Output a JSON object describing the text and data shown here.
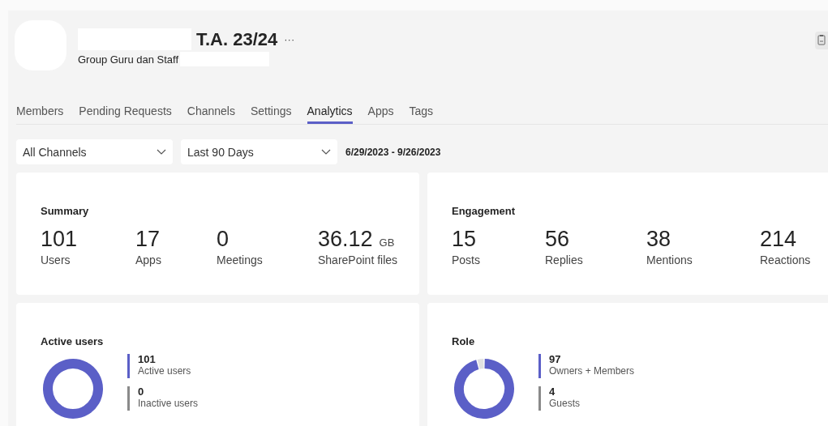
{
  "header": {
    "title": "T.A. 23/24",
    "more": "···",
    "subtitle": "Group Guru dan Staff"
  },
  "tabs": [
    {
      "label": "Members",
      "selected": false
    },
    {
      "label": "Pending Requests",
      "selected": false
    },
    {
      "label": "Channels",
      "selected": false
    },
    {
      "label": "Settings",
      "selected": false
    },
    {
      "label": "Analytics",
      "selected": true
    },
    {
      "label": "Apps",
      "selected": false
    },
    {
      "label": "Tags",
      "selected": false
    }
  ],
  "filters": {
    "channel": "All Channels",
    "period": "Last 90 Days",
    "date_range": "6/29/2023 - 9/26/2023"
  },
  "summary": {
    "title": "Summary",
    "stats": [
      {
        "value": "101",
        "label": "Users"
      },
      {
        "value": "17",
        "label": "Apps"
      },
      {
        "value": "0",
        "label": "Meetings"
      },
      {
        "value": "36.12",
        "unit": "GB",
        "label": "SharePoint files"
      }
    ]
  },
  "engagement": {
    "title": "Engagement",
    "stats": [
      {
        "value": "15",
        "label": "Posts"
      },
      {
        "value": "56",
        "label": "Replies"
      },
      {
        "value": "38",
        "label": "Mentions"
      },
      {
        "value": "214",
        "label": "Reactions"
      }
    ]
  },
  "active_users": {
    "title": "Active users",
    "legend": [
      {
        "value": "101",
        "label": "Active users",
        "color": "#5b5fc7"
      },
      {
        "value": "0",
        "label": "Inactive users",
        "color": "#8a8a8a"
      }
    ]
  },
  "role": {
    "title": "Role",
    "legend": [
      {
        "value": "97",
        "label": "Owners + Members",
        "color": "#5b5fc7"
      },
      {
        "value": "4",
        "label": "Guests",
        "color": "#8a8a8a"
      }
    ]
  }
}
